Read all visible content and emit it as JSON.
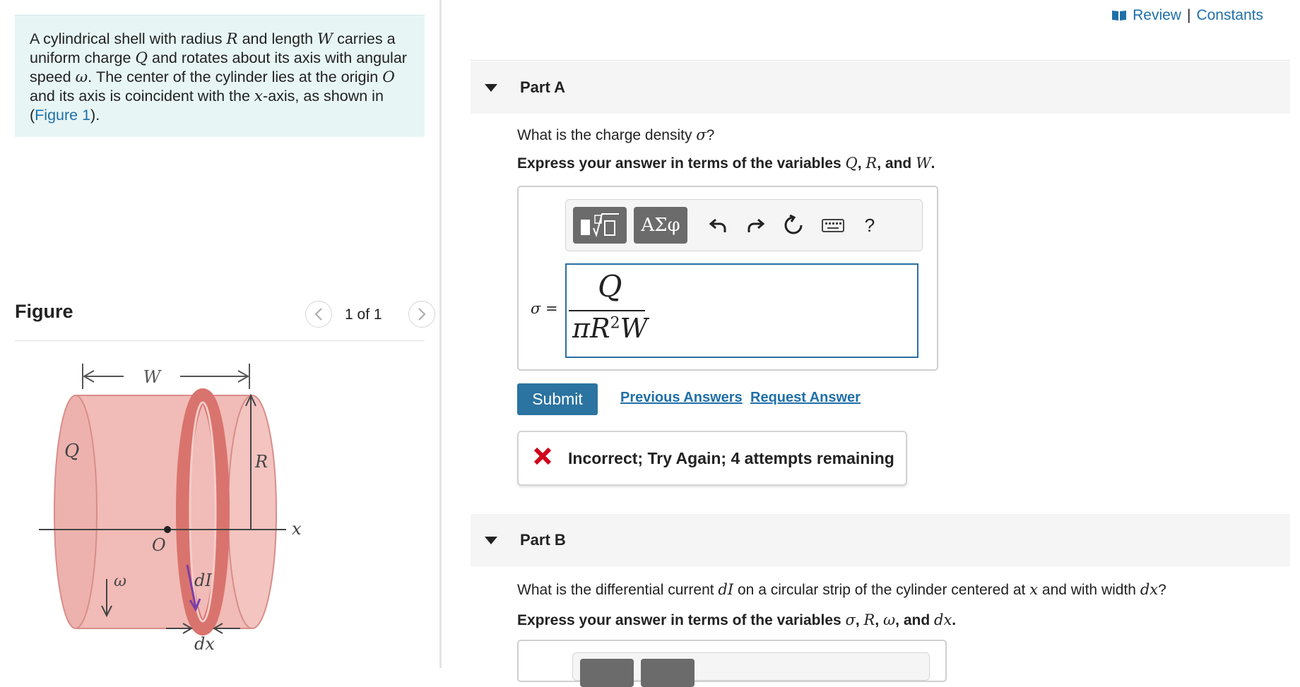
{
  "header": {
    "review_label": "Review",
    "separator": "|",
    "constants_label": "Constants"
  },
  "problem": {
    "text_1": "A cylindrical shell with radius ",
    "var_R": "R",
    "text_2": " and length ",
    "var_W": "W",
    "text_3": " carries a uniform charge ",
    "var_Q": "Q",
    "text_4": " and rotates about its axis with angular speed ",
    "var_omega": "ω",
    "text_5": ". The center of the cylinder lies at the origin ",
    "var_O": "O",
    "text_6": " and its axis is coincident with the ",
    "var_x": "x",
    "text_7": "-axis, as shown in (",
    "figure_link": "Figure 1",
    "text_8": ")."
  },
  "figure": {
    "title": "Figure",
    "page_indicator": "1 of 1",
    "labels": {
      "W": "W",
      "Q": "Q",
      "R": "R",
      "O": "O",
      "x": "x",
      "omega": "ω",
      "dI": "dI",
      "dx": "dx"
    },
    "colors": {
      "cylinder": "#eeb2ae",
      "cylinder_edge": "#d88d88",
      "strip": "#d9736d",
      "arrow": "#7a3ea8"
    }
  },
  "partA": {
    "label": "Part A",
    "question_prefix": "What is the charge density ",
    "question_var": "σ",
    "question_suffix": "?",
    "instruction_prefix": "Express your answer in terms of the variables ",
    "instruction_vars": [
      "Q",
      "R",
      "W"
    ],
    "instruction_sep_1": ", ",
    "instruction_sep_2": ", and ",
    "instruction_suffix": ".",
    "toolbar": {
      "templates_icon": "templates-icon",
      "symbols_label": "ΑΣφ",
      "undo_icon": "undo-icon",
      "redo_icon": "redo-icon",
      "reset_icon": "reset-icon",
      "keyboard_icon": "keyboard-icon",
      "help_label": "?"
    },
    "equation_label": "σ =",
    "answer_numerator": "Q",
    "answer_denominator_pi_R": "πR",
    "answer_exponent": "2",
    "answer_denominator_W": "W",
    "submit_label": "Submit",
    "previous_answers_label": "Previous Answers",
    "request_answer_label": "Request Answer",
    "feedback": "Incorrect; Try Again; 4 attempts remaining",
    "feedback_color": "#d0021b"
  },
  "partB": {
    "label": "Part B",
    "question_prefix": "What is the differential current ",
    "question_var_dI": "dI",
    "question_mid": " on a circular strip of the cylinder centered at ",
    "question_var_x": "x",
    "question_mid2": " and with width ",
    "question_var_dx": "dx",
    "question_suffix": "?",
    "instruction_prefix": "Express your answer in terms of the variables ",
    "instruction_var_1": "σ",
    "instruction_var_2": "R",
    "instruction_var_3": "ω",
    "instruction_var_4": "dx",
    "instruction_sep": ", ",
    "instruction_and": ", and ",
    "instruction_suffix": "."
  }
}
